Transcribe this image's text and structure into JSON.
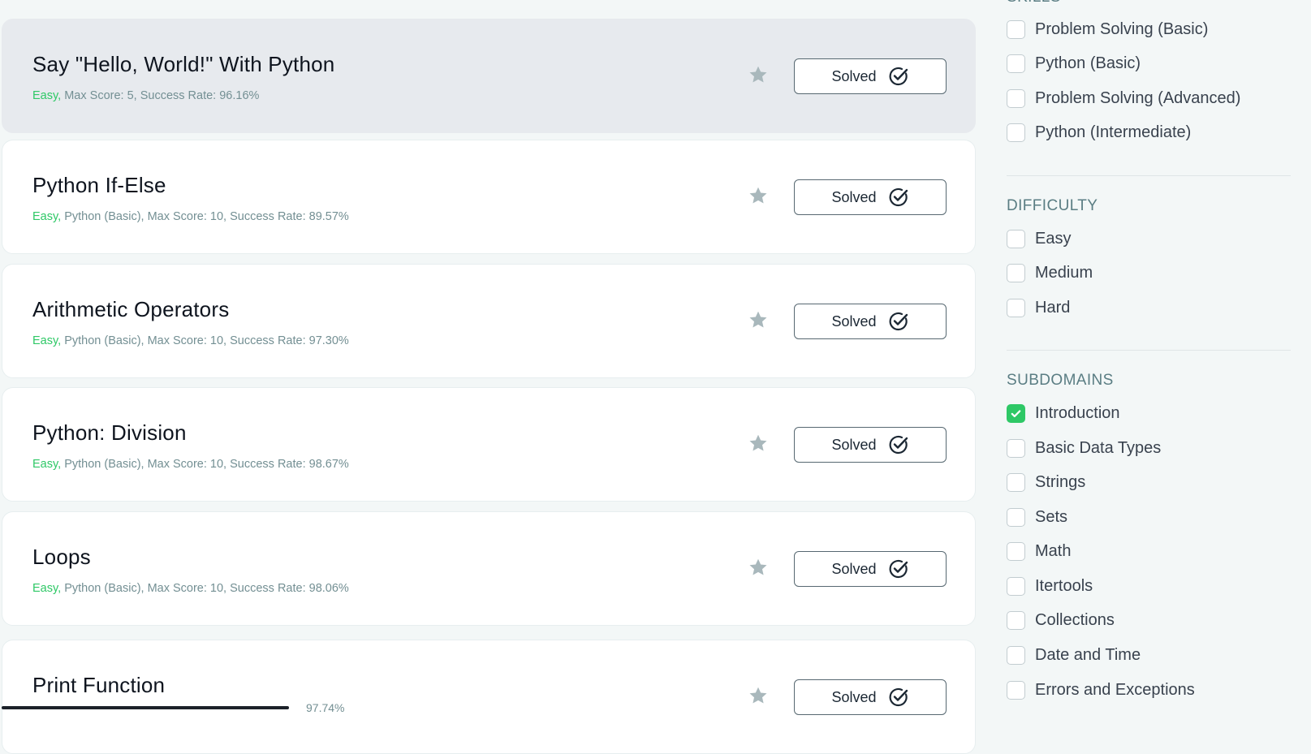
{
  "challenges": [
    {
      "title": "Say \"Hello, World!\" With Python",
      "difficulty": "Easy,",
      "meta": " Max Score: 5, Success Rate: 96.16%",
      "button": "Solved"
    },
    {
      "title": "Python If-Else",
      "difficulty": "Easy,",
      "meta": " Python (Basic), Max Score: 10, Success Rate: 89.57%",
      "button": "Solved"
    },
    {
      "title": "Arithmetic Operators",
      "difficulty": "Easy,",
      "meta": " Python (Basic), Max Score: 10, Success Rate: 97.30%",
      "button": "Solved"
    },
    {
      "title": "Python: Division",
      "difficulty": "Easy,",
      "meta": " Python (Basic), Max Score: 10, Success Rate: 98.67%",
      "button": "Solved"
    },
    {
      "title": "Loops",
      "difficulty": "Easy,",
      "meta": " Python (Basic), Max Score: 10, Success Rate: 98.06%",
      "button": "Solved"
    },
    {
      "title": "Print Function",
      "difficulty": "",
      "meta": "",
      "button": "Solved"
    }
  ],
  "partial_text": "97.74%",
  "sidebar": {
    "skills": {
      "heading": "SKILLS",
      "options": [
        "Problem Solving (Basic)",
        "Python (Basic)",
        "Problem Solving (Advanced)",
        "Python (Intermediate)"
      ]
    },
    "difficulty": {
      "heading": "DIFFICULTY",
      "options": [
        "Easy",
        "Medium",
        "Hard"
      ]
    },
    "subdomains": {
      "heading": "SUBDOMAINS",
      "options": [
        "Introduction",
        "Basic Data Types",
        "Strings",
        "Sets",
        "Math",
        "Itertools",
        "Collections",
        "Date and Time",
        "Errors and Exceptions"
      ],
      "checked": "Introduction"
    }
  },
  "colors": {
    "easy": "#2ec866",
    "checkbox_checked": "#2ec866",
    "section_heading": "#5a7d83",
    "star": "#a9b8bc"
  },
  "icons": {
    "star": "star-icon",
    "solved": "check-circle-icon",
    "checkmark": "checkmark-icon"
  }
}
